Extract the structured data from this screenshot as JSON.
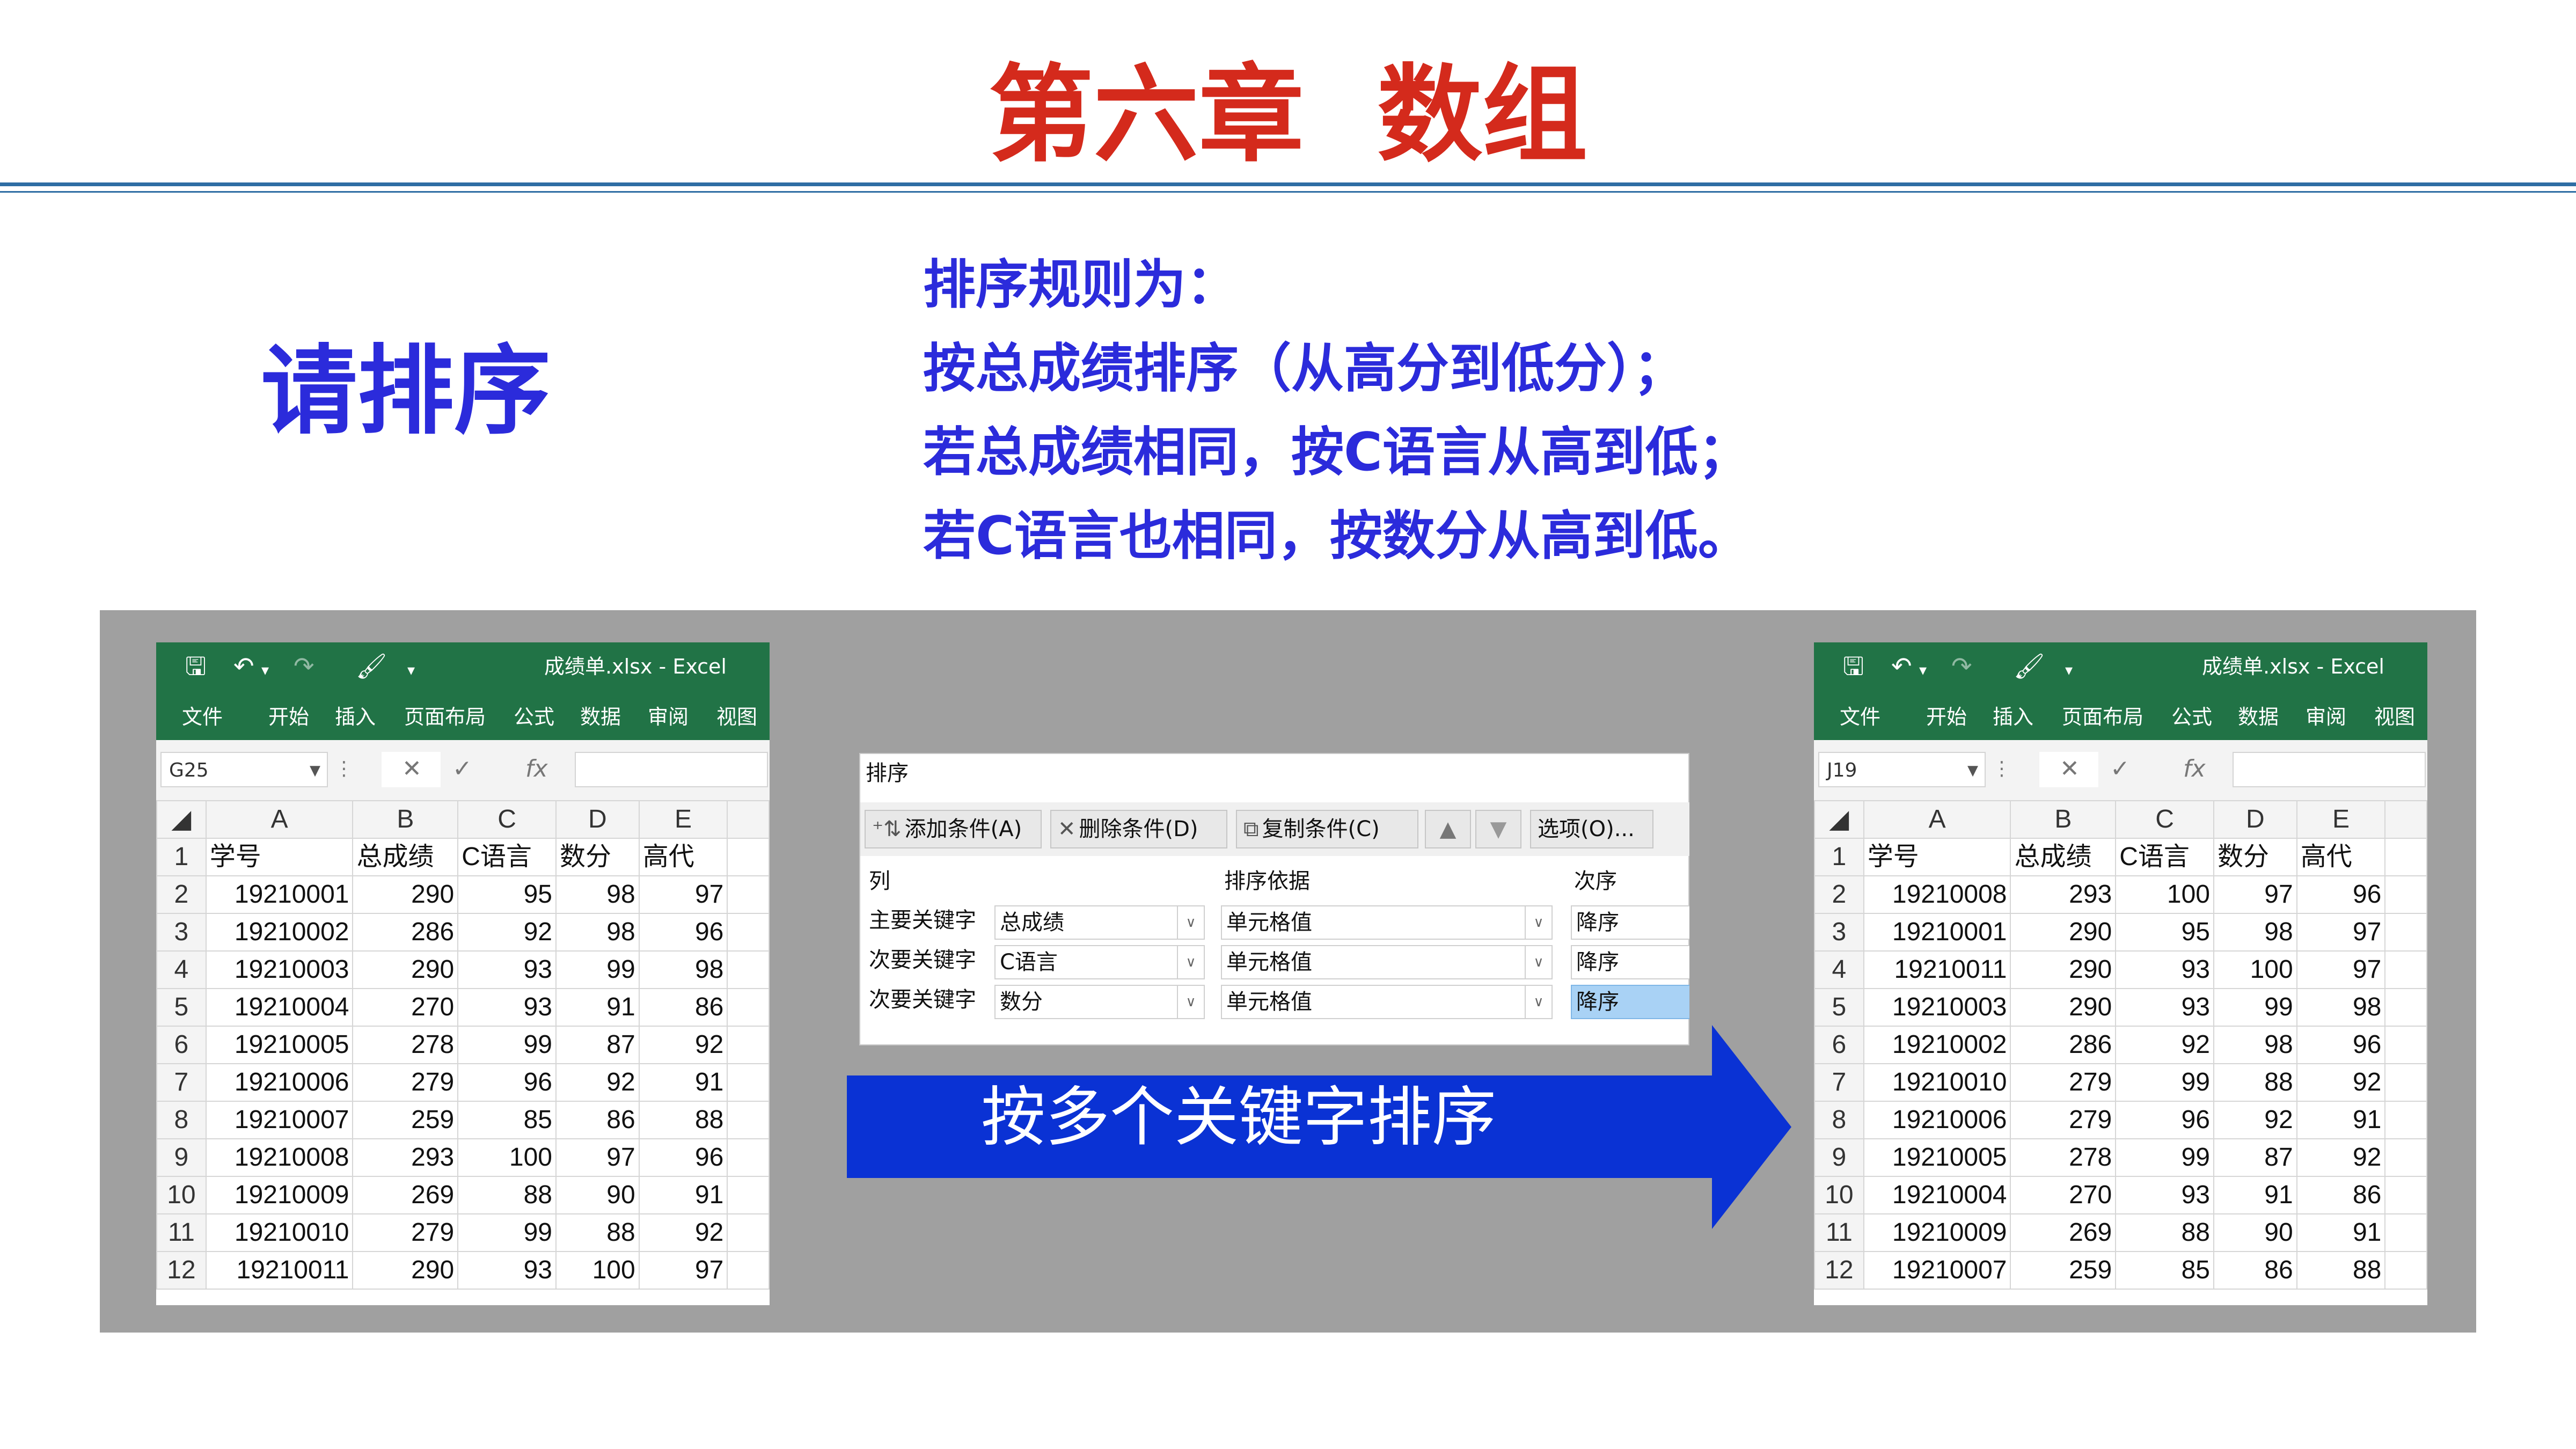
{
  "slide": {
    "title": "第六章  数组",
    "prompt": "请排序",
    "rules": [
      "排序规则为：",
      "按总成绩排序（从高分到低分）；",
      "若总成绩相同，按C语言从高到低；",
      "若C语言也相同，按数分从高到低。"
    ]
  },
  "excel_left": {
    "window_title": "成绩单.xlsx  -  Excel",
    "menu": [
      "文件",
      "开始",
      "插入",
      "页面布局",
      "公式",
      "数据",
      "审阅",
      "视图"
    ],
    "name_box": "G25",
    "columns": [
      "A",
      "B",
      "C",
      "D",
      "E"
    ],
    "rows": [
      [
        "1",
        "学号",
        "总成绩",
        "C语言",
        "数分",
        "高代"
      ],
      [
        "2",
        "19210001",
        "290",
        "95",
        "98",
        "97"
      ],
      [
        "3",
        "19210002",
        "286",
        "92",
        "98",
        "96"
      ],
      [
        "4",
        "19210003",
        "290",
        "93",
        "99",
        "98"
      ],
      [
        "5",
        "19210004",
        "270",
        "93",
        "91",
        "86"
      ],
      [
        "6",
        "19210005",
        "278",
        "99",
        "87",
        "92"
      ],
      [
        "7",
        "19210006",
        "279",
        "96",
        "92",
        "91"
      ],
      [
        "8",
        "19210007",
        "259",
        "85",
        "86",
        "88"
      ],
      [
        "9",
        "19210008",
        "293",
        "100",
        "97",
        "96"
      ],
      [
        "10",
        "19210009",
        "269",
        "88",
        "90",
        "91"
      ],
      [
        "11",
        "19210010",
        "279",
        "99",
        "88",
        "92"
      ],
      [
        "12",
        "19210011",
        "290",
        "93",
        "100",
        "97"
      ]
    ]
  },
  "excel_right": {
    "window_title": "成绩单.xlsx  -  Excel",
    "menu": [
      "文件",
      "开始",
      "插入",
      "页面布局",
      "公式",
      "数据",
      "审阅",
      "视图"
    ],
    "name_box": "J19",
    "columns": [
      "A",
      "B",
      "C",
      "D",
      "E"
    ],
    "rows": [
      [
        "1",
        "学号",
        "总成绩",
        "C语言",
        "数分",
        "高代"
      ],
      [
        "2",
        "19210008",
        "293",
        "100",
        "97",
        "96"
      ],
      [
        "3",
        "19210001",
        "290",
        "95",
        "98",
        "97"
      ],
      [
        "4",
        "19210011",
        "290",
        "93",
        "100",
        "97"
      ],
      [
        "5",
        "19210003",
        "290",
        "93",
        "99",
        "98"
      ],
      [
        "6",
        "19210002",
        "286",
        "92",
        "98",
        "96"
      ],
      [
        "7",
        "19210010",
        "279",
        "99",
        "88",
        "92"
      ],
      [
        "8",
        "19210006",
        "279",
        "96",
        "92",
        "91"
      ],
      [
        "9",
        "19210005",
        "278",
        "99",
        "87",
        "92"
      ],
      [
        "10",
        "19210004",
        "270",
        "93",
        "91",
        "86"
      ],
      [
        "11",
        "19210009",
        "269",
        "88",
        "90",
        "91"
      ],
      [
        "12",
        "19210007",
        "259",
        "85",
        "86",
        "88"
      ]
    ]
  },
  "sort_dialog": {
    "title": "排序",
    "buttons": {
      "add": "添加条件(A)",
      "delete": "删除条件(D)",
      "copy": "复制条件(C)",
      "options": "选项(O)..."
    },
    "headers": {
      "column": "列",
      "sort_on": "排序依据",
      "order": "次序"
    },
    "rows": [
      {
        "label": "主要关键字",
        "column": "总成绩",
        "sort_on": "单元格值",
        "order": "降序"
      },
      {
        "label": "次要关键字",
        "column": "C语言",
        "sort_on": "单元格值",
        "order": "降序"
      },
      {
        "label": "次要关键字",
        "column": "数分",
        "sort_on": "单元格值",
        "order": "降序"
      }
    ]
  },
  "arrow_label": "按多个关键字排序",
  "colors": {
    "title_red": "#d42a1c",
    "text_blue": "#2b2bdb",
    "excel_green": "#217346",
    "arrow_blue": "#0a32d4",
    "panel_grey": "#a0a0a0"
  },
  "icons": [
    "save-icon",
    "undo-icon",
    "redo-icon",
    "format-painter-icon",
    "customize-icon",
    "cancel-icon",
    "enter-icon",
    "fx-icon",
    "add-icon",
    "delete-icon",
    "copy-icon",
    "move-up-icon",
    "move-down-icon"
  ]
}
